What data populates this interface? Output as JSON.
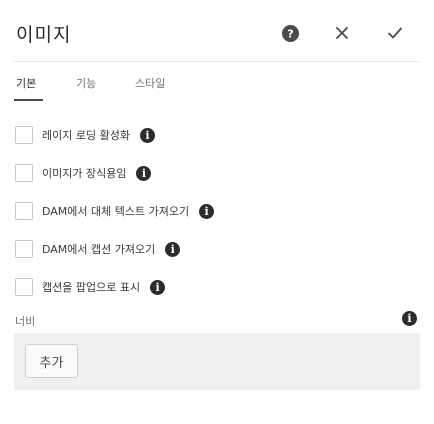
{
  "dialog": {
    "title": "이미지",
    "help_icon": "help-circle-icon",
    "close_icon": "close-icon",
    "done_icon": "checkmark-icon"
  },
  "tabs": [
    {
      "label": "기본",
      "active": true
    },
    {
      "label": "기능",
      "active": false
    },
    {
      "label": "스타일",
      "active": false
    }
  ],
  "options": [
    {
      "label": "레이지 로딩 활성화",
      "checked": false,
      "info_icon": "info-icon"
    },
    {
      "label": "이미지가 장식용임",
      "checked": false,
      "info_icon": "info-icon"
    },
    {
      "label": "DAM에서 대체 텍스트 가져오기",
      "checked": false,
      "info_icon": "info-icon"
    },
    {
      "label": "DAM에서 캡션 가져오기",
      "checked": false,
      "info_icon": "info-icon"
    },
    {
      "label": "캡션을 팝업으로 표시",
      "checked": false,
      "info_icon": "info-icon"
    }
  ],
  "width": {
    "label": "너비",
    "info_icon": "info-icon",
    "add_label": "추가"
  },
  "colors": {
    "accent": "#4b4b4b",
    "panel_bg": "#f0f0f0",
    "info_bg": "#2c2c2c"
  }
}
